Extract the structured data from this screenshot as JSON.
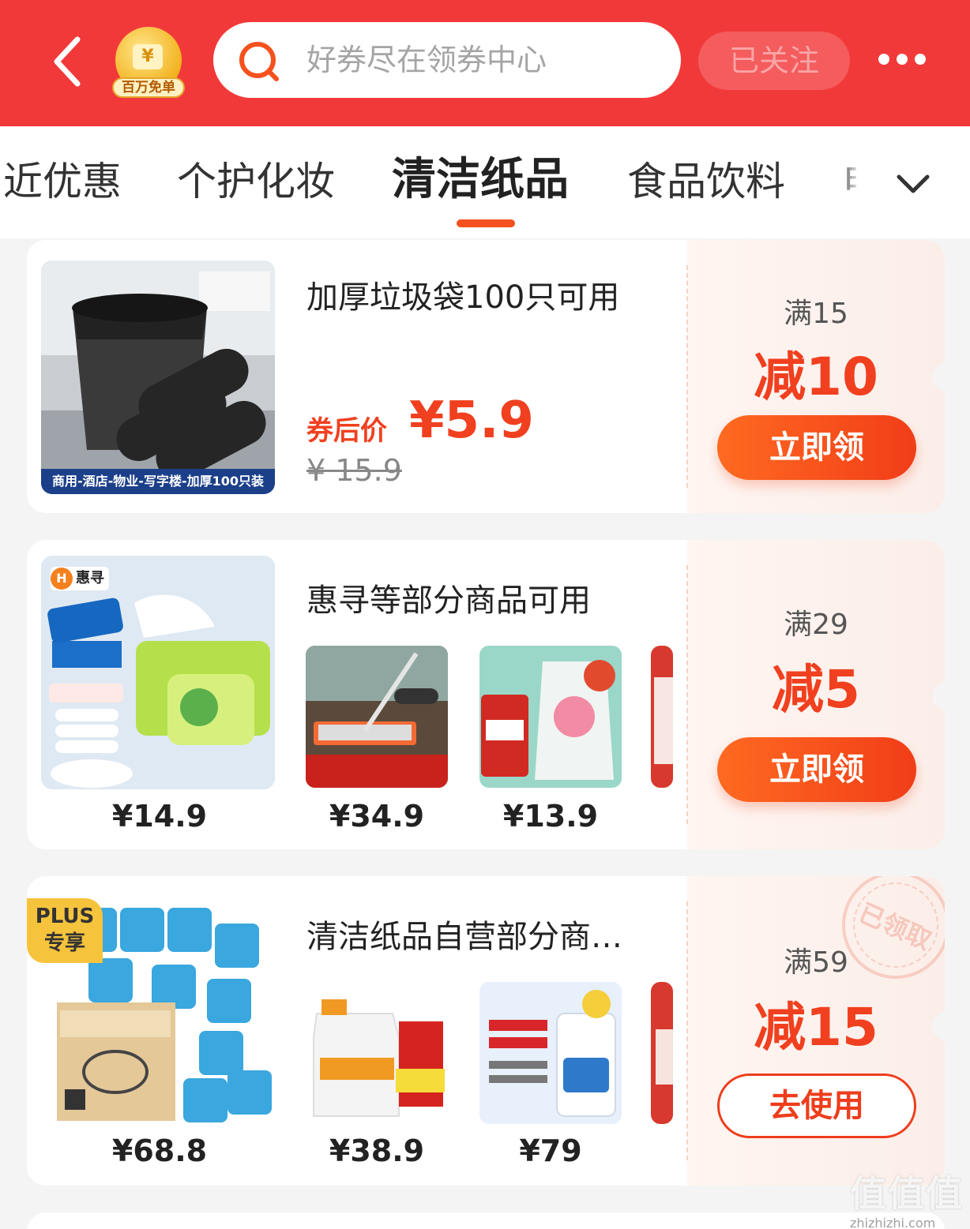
{
  "header": {
    "badge_label": "百万免单",
    "search_placeholder": "好券尽在领券中心",
    "follow_label": "已关注"
  },
  "tabs": [
    {
      "label": "近优惠"
    },
    {
      "label": "个护化妆"
    },
    {
      "label": "清洁纸品"
    },
    {
      "label": "食品饮料"
    },
    {
      "label": "电"
    }
  ],
  "active_tab": "清洁纸品",
  "cards": [
    {
      "title": "加厚垃圾袋100只可用",
      "image_caption": "商用-酒店-物业-写字楼-加厚100只装",
      "after_label": "券后价",
      "after_price": "¥5.9",
      "original_price": "¥ 15.9",
      "threshold": "满15",
      "discount": "减10",
      "button": "立即领"
    },
    {
      "title": "惠寻等部分商品可用",
      "brand": "惠寻",
      "main_price": "¥14.9",
      "items": [
        {
          "price": "¥34.9"
        },
        {
          "price": "¥13.9"
        }
      ],
      "threshold": "满29",
      "discount": "减5",
      "button": "立即领"
    },
    {
      "title": "清洁纸品自营部分商…",
      "plus_badge": "PLUS专享",
      "main_price": "¥68.8",
      "items": [
        {
          "price": "¥38.9"
        },
        {
          "price": "¥79"
        }
      ],
      "threshold": "满59",
      "discount": "减15",
      "button": "去使用",
      "stamp": "已领取"
    }
  ],
  "watermark": {
    "mark": "值值值",
    "url": "zhizhizhi.com"
  },
  "colors": {
    "header_bg": "#f2393a",
    "accent": "#f0401f",
    "tab_indicator": "#f4511e"
  }
}
